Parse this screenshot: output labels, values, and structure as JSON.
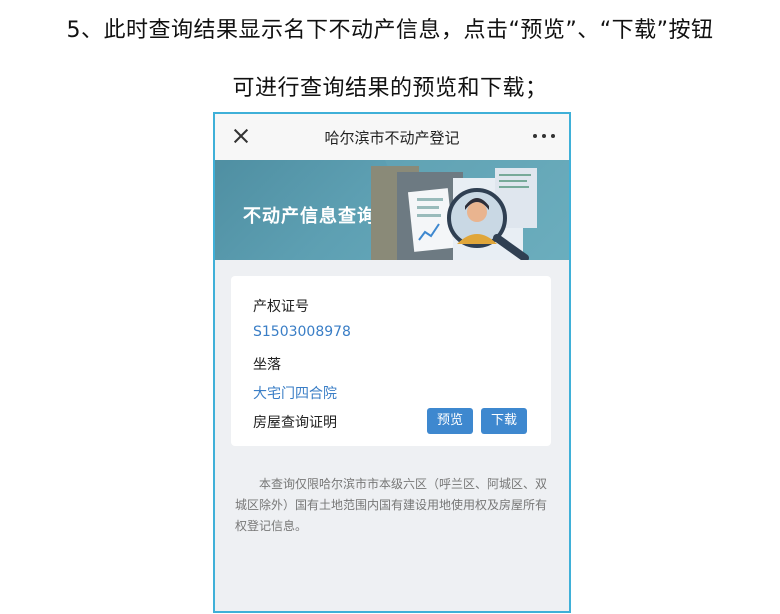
{
  "caption": {
    "line1": "5、此时查询结果显示名下不动产信息，点击“预览”、“下载”按钮",
    "line2": "可进行查询结果的预览和下载；"
  },
  "topbar": {
    "title": "哈尔滨市不动产登记",
    "close_icon": "close-icon",
    "more_icon": "more-icon"
  },
  "banner": {
    "title": "不动产信息查询"
  },
  "result": {
    "cert_label": "产权证号",
    "cert_value": "S1503008978",
    "location_label": "坐落",
    "location_value": "大宅门四合院",
    "proof_label": "房屋查询证明",
    "preview_label": "预览",
    "download_label": "下载"
  },
  "note": "本查询仅限哈尔滨市市本级六区（呼兰区、阿城区、双城区除外）国有土地范围内国有建设用地使用权及房屋所有权登记信息。",
  "colors": {
    "accent": "#3e88cf",
    "link": "#3a7ec6",
    "banner": "#5d9fb2",
    "frame": "#3fb0d8"
  }
}
